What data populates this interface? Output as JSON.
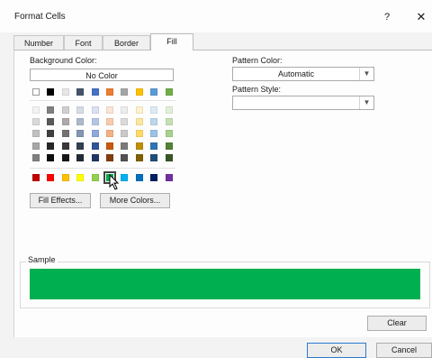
{
  "window": {
    "title": "Format Cells",
    "help": "?",
    "close": "✕"
  },
  "tabs": [
    {
      "label": "Number",
      "active": false
    },
    {
      "label": "Font",
      "active": false
    },
    {
      "label": "Border",
      "active": false
    },
    {
      "label": "Fill",
      "active": true
    }
  ],
  "fill": {
    "background_color_label": "Background Color:",
    "no_color": "No Color",
    "theme_row": [
      "#ffffff",
      "#000000",
      "#e7e6e6",
      "#44546a",
      "#4472c4",
      "#ed7d31",
      "#a5a5a5",
      "#ffc000",
      "#5b9bd5",
      "#70ad47"
    ],
    "shade_rows": [
      [
        "#f2f2f2",
        "#7f7f7f",
        "#d0cece",
        "#d6dce4",
        "#d9e1f2",
        "#fce4d6",
        "#ededed",
        "#fff2cc",
        "#ddebf7",
        "#e2efda"
      ],
      [
        "#d9d9d9",
        "#595959",
        "#aeaaaa",
        "#acb9ca",
        "#b4c6e7",
        "#f8cbad",
        "#dbdbdb",
        "#ffe699",
        "#bdd7ee",
        "#c6e0b4"
      ],
      [
        "#bfbfbf",
        "#404040",
        "#757171",
        "#8497b0",
        "#8ea9db",
        "#f4b084",
        "#c9c9c9",
        "#ffd966",
        "#9bc2e6",
        "#a9d08e"
      ],
      [
        "#a6a6a6",
        "#262626",
        "#3a3838",
        "#333f4f",
        "#305496",
        "#c65911",
        "#7b7b7b",
        "#bf8f00",
        "#2f75b5",
        "#548235"
      ],
      [
        "#808080",
        "#0d0d0d",
        "#161616",
        "#222b35",
        "#203764",
        "#833c0c",
        "#525252",
        "#806000",
        "#1f4e78",
        "#375623"
      ]
    ],
    "standard_row": [
      "#c00000",
      "#ff0000",
      "#ffc000",
      "#ffff00",
      "#92d050",
      "#00b050",
      "#00b0f0",
      "#0070c0",
      "#002060",
      "#7030a0"
    ],
    "selected_index": 5,
    "fill_effects": "Fill Effects...",
    "more_colors": "More Colors...",
    "pattern_color_label": "Pattern Color:",
    "pattern_color_value": "Automatic",
    "pattern_style_label": "Pattern Style:",
    "pattern_style_value": "",
    "sample_label": "Sample",
    "sample_color": "#00b050",
    "clear": "Clear"
  },
  "footer": {
    "ok": "OK",
    "cancel": "Cancel"
  }
}
